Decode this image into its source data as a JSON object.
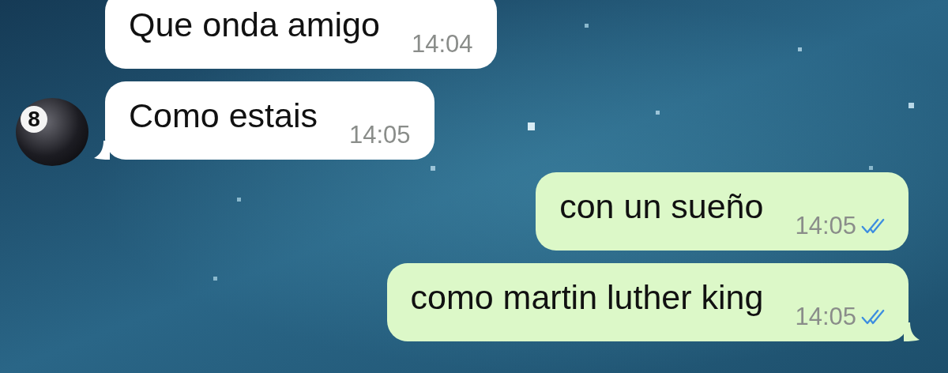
{
  "messages": [
    {
      "kind": "incoming",
      "text": "Que onda amigo",
      "time": "14:04",
      "tail": false
    },
    {
      "kind": "incoming",
      "text": "Como estais",
      "time": "14:05",
      "tail": true,
      "avatar": {
        "label": "8"
      }
    },
    {
      "kind": "outgoing",
      "text": "con un sueño",
      "time": "14:05",
      "tail": false,
      "read": true
    },
    {
      "kind": "outgoing",
      "text": "como martin luther king",
      "time": "14:05",
      "tail": true,
      "read": true
    }
  ]
}
